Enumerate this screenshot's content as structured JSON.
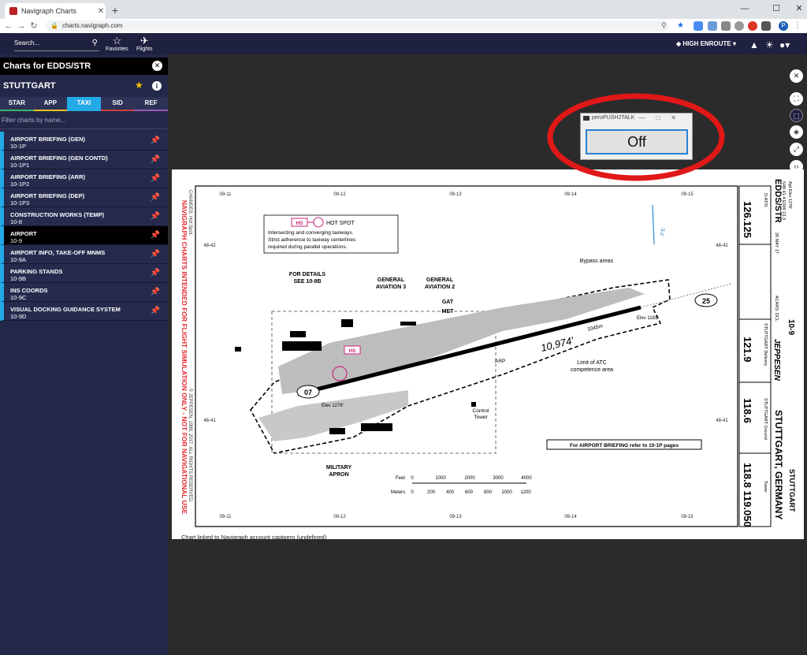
{
  "browser": {
    "tab_title": "Navigraph Charts",
    "url": "charts.navigraph.com",
    "avatar_letter": "P"
  },
  "header": {
    "search_placeholder": "Search...",
    "favorites_label": "Favorites",
    "flights_label": "Flights",
    "layer_label": "HIGH ENROUTE"
  },
  "sidebar": {
    "title": "Charts for EDDS/STR",
    "airport": "STUTTGART",
    "tabs": [
      {
        "label": "STAR",
        "color": "#3bb56b"
      },
      {
        "label": "APP",
        "color": "#f0c020"
      },
      {
        "label": "TAXI",
        "color": "#22a9e6"
      },
      {
        "label": "SID",
        "color": "#d04040"
      },
      {
        "label": "REF",
        "color": "#9b59b6"
      }
    ],
    "filter_placeholder": "Filter charts by name...",
    "charts": [
      {
        "name": "AIRPORT BRIEFING (GEN)",
        "code": "10-1P"
      },
      {
        "name": "AIRPORT BRIEFING (GEN CONTD)",
        "code": "10-1P1"
      },
      {
        "name": "AIRPORT BRIEFING (ARR)",
        "code": "10-1P2"
      },
      {
        "name": "AIRPORT BRIEFING (DEP)",
        "code": "10-1P3"
      },
      {
        "name": "CONSTRUCTION WORKS (TEMP)",
        "code": "10-8"
      },
      {
        "name": "AIRPORT",
        "code": "10-9"
      },
      {
        "name": "AIRPORT INFO, TAKE-OFF MNMS",
        "code": "10-9A"
      },
      {
        "name": "PARKING STANDS",
        "code": "10-9B"
      },
      {
        "name": "INS COORDS",
        "code": "10-9C"
      },
      {
        "name": "VISUAL DOCKING GUIDANCE SYSTEM",
        "code": "10-9D"
      }
    ]
  },
  "popup": {
    "title": "peroPUSH2TALK",
    "button_label": "Off"
  },
  "chart": {
    "side_warning": "NAVIGRAPH CHARTS INTENDED FOR FLIGHT SIMULATION ONLY - NOT FOR NAVIGATIONAL USE",
    "copyright": "© JEPPESEN, 1998, 2017. ALL RIGHTS RESERVED.",
    "changes": "CHANGES: Hot Spot.",
    "top_ticks": [
      "09-11",
      "09-12",
      "09-13",
      "09-14",
      "09-15"
    ],
    "lat_ticks": [
      "48-42",
      "48-41"
    ],
    "hotspot_label": "HS",
    "hotspot_title": "HOT SPOT",
    "hotspot_text_1": "Intersecting and converging taxiways.",
    "hotspot_text_2": "Strict adherence to taxiway centerlines",
    "hotspot_text_3": "required during parallel operations.",
    "details_1": "FOR DETAILS",
    "details_2": "SEE 10-9B",
    "ga3_1": "GENERAL",
    "ga3_2": "AVIATION 3",
    "ga2_1": "GENERAL",
    "ga2_2": "AVIATION 2",
    "gat": "GAT",
    "met": "MET",
    "bypass": "Bypass areas",
    "runway_length": "10,974'",
    "runway_m": "3345m",
    "atc_limit_1": "Limit of ATC",
    "atc_limit_2": "competence area",
    "rwy_07": "07",
    "rwy_25": "25",
    "elev_1276": "Elev 1276'",
    "elev_1181": "Elev 1181'",
    "arp": "ARP",
    "control_tower_1": "Control",
    "control_tower_2": "Tower",
    "military_1": "MILITARY",
    "military_2": "APRON",
    "briefing_box": "For AIRPORT BRIEFING refer to 10-1P pages",
    "scale_feet_label": "Feet",
    "scale_feet": [
      "0",
      "1000",
      "2000",
      "3000",
      "4000"
    ],
    "scale_m_label": "Meters",
    "scale_m": [
      "0",
      "200",
      "400",
      "600",
      "800",
      "1000",
      "1200"
    ],
    "mag_var": "3°E",
    "icao": "EDDS/STR",
    "apt_elev": "Apt Elev 1276'",
    "coords": "N48 41.4 E009 13.3",
    "datis_label": "D-ATIS",
    "datis_freq": "126.125",
    "acars": "ACARS: DCL",
    "date": "26 MAY 17",
    "chart_no": "10-9",
    "delivery_label": "STUTTGART Delivery",
    "delivery_freq": "121.9",
    "ground_label": "STUTTGART Ground",
    "ground_freq": "118.6",
    "tower_label": "Tower",
    "tower_freqs": "118.8  119.050",
    "brand": "JEPPESEN",
    "city_title": "STUTTGART, GERMANY",
    "city_sub": "STUTTGART",
    "linked_caption": "Chart linked to Navigraph account captpero (undefined)"
  }
}
